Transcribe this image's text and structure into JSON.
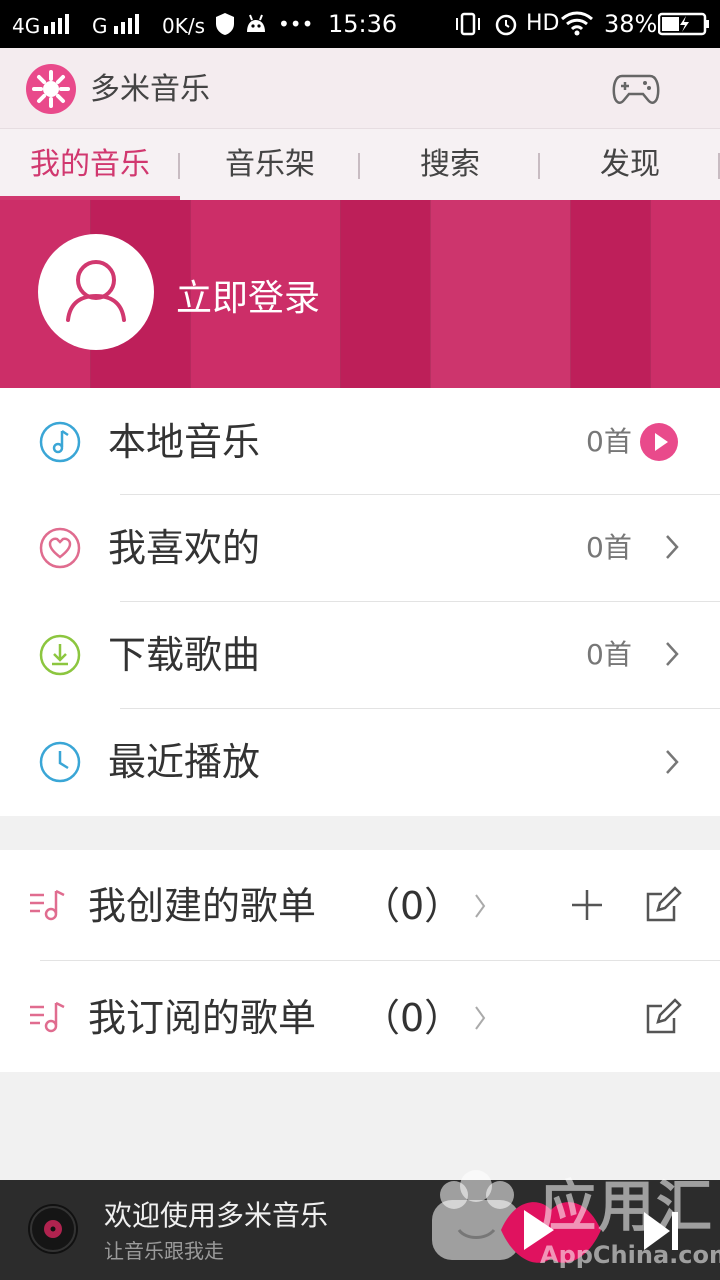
{
  "status_bar": {
    "network": "4G",
    "network2": "G",
    "speed": "0K/s",
    "more": "•••",
    "time": "15:36",
    "hd": "HD",
    "battery": "38%"
  },
  "app": {
    "title": "多米音乐",
    "colors": {
      "accent": "#d1386f",
      "banner": "#c9215f",
      "pink": "#e94a8b"
    }
  },
  "tabs": [
    {
      "label": "我的音乐",
      "active": true
    },
    {
      "label": "音乐架"
    },
    {
      "label": "搜索"
    },
    {
      "label": "发现"
    }
  ],
  "banner": {
    "login": "立即登录"
  },
  "menu": [
    {
      "label": "本地音乐",
      "count": "0首",
      "icon": "music-note-icon"
    },
    {
      "label": "我喜欢的",
      "count": "0首",
      "icon": "heart-icon"
    },
    {
      "label": "下载歌曲",
      "count": "0首",
      "icon": "download-icon"
    },
    {
      "label": "最近播放",
      "count": "",
      "icon": "clock-icon"
    }
  ],
  "playlists": [
    {
      "label": "我创建的歌单",
      "count": "（0）"
    },
    {
      "label": "我订阅的歌单",
      "count": "（0）"
    }
  ],
  "player": {
    "title": "欢迎使用多米音乐",
    "subtitle": "让音乐跟我走"
  },
  "watermark": {
    "text": "应用汇",
    "domain": "AppChina.com"
  }
}
